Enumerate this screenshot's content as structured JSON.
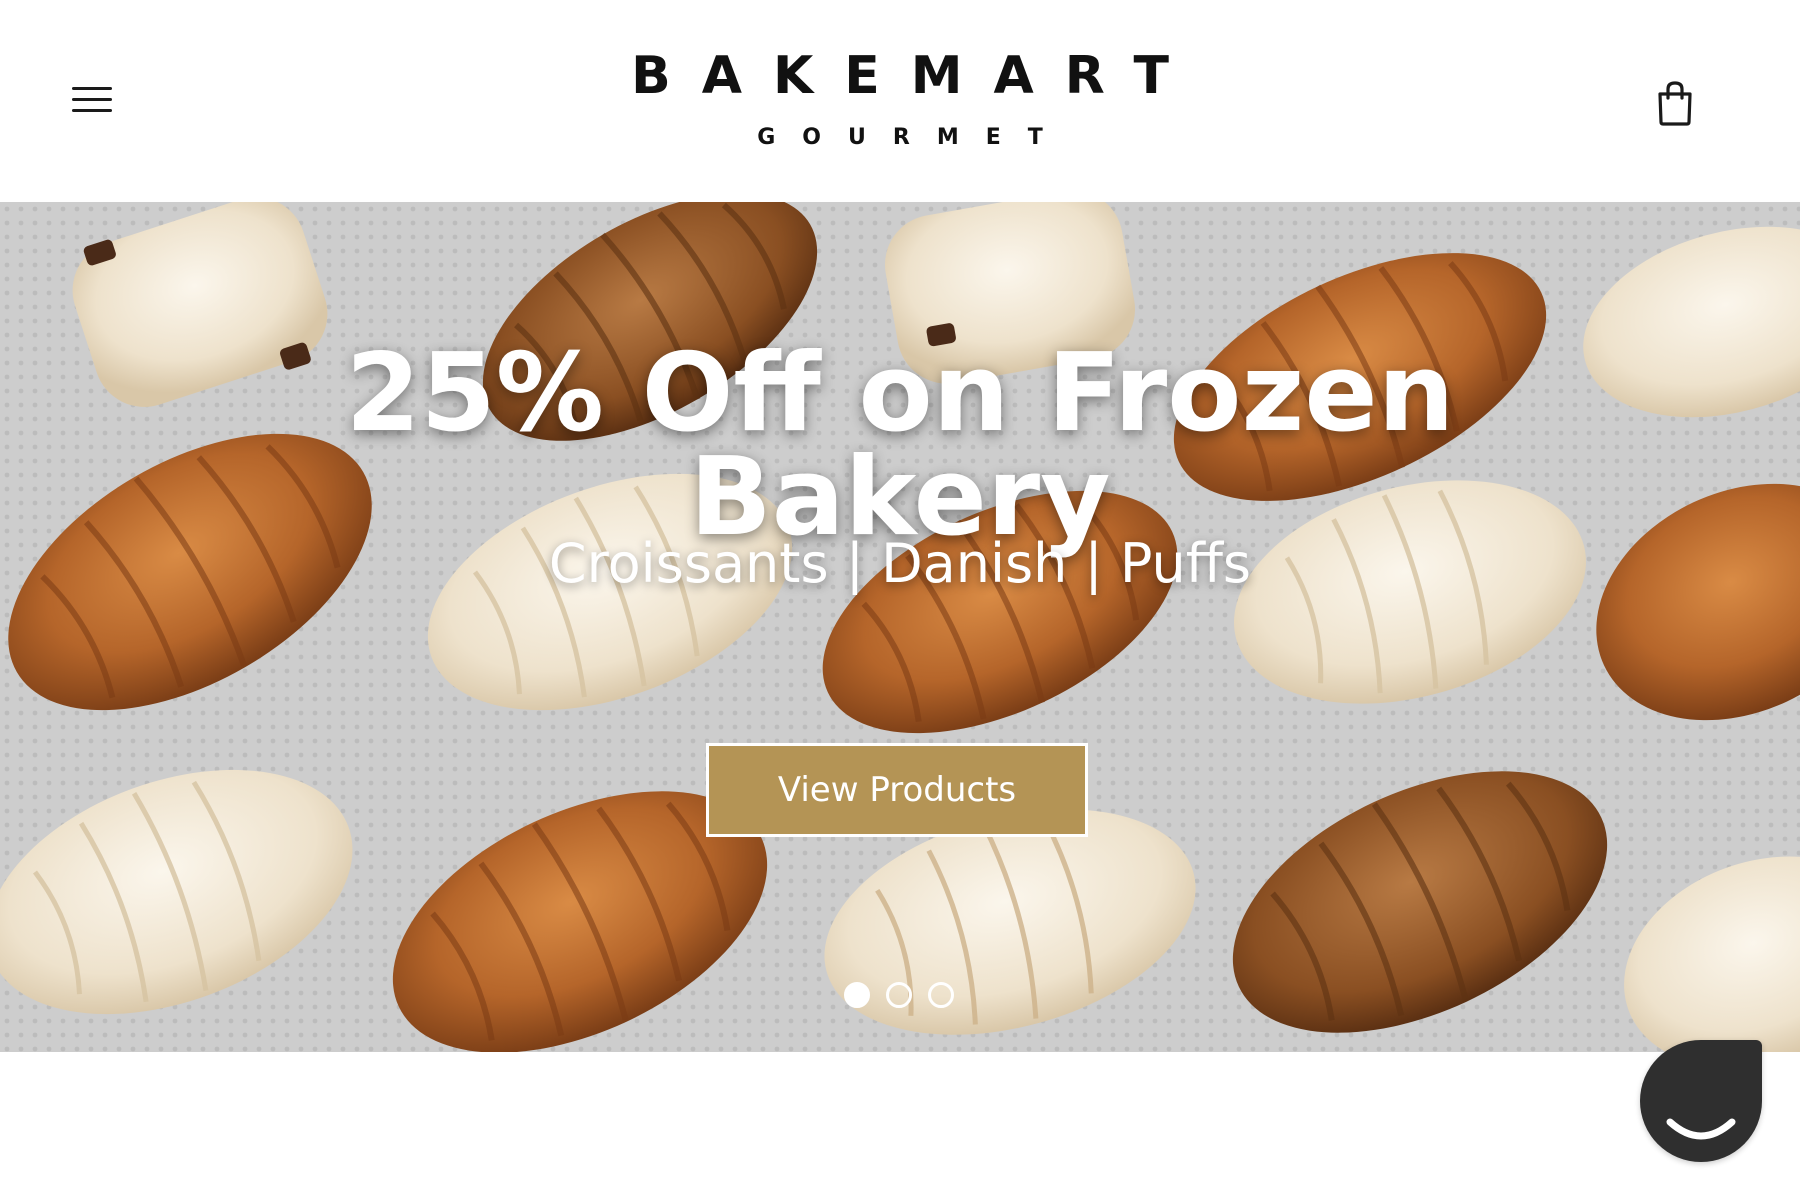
{
  "header": {
    "brand_name": "BAKEMART",
    "brand_sub": "GOURMET",
    "menu_icon": "hamburger-menu-icon",
    "cart_icon": "shopping-bag-icon"
  },
  "hero": {
    "title_line1": "25% Off on Frozen",
    "title_line2": "Bakery",
    "subtitle": "Croissants | Danish | Puffs",
    "cta_label": "View Products",
    "slides": [
      {
        "active": true
      },
      {
        "active": false
      },
      {
        "active": false
      }
    ]
  },
  "chat": {
    "icon": "smile-chat-icon"
  },
  "colors": {
    "cta_background": "#b49455",
    "text_dark": "#111111",
    "chat_widget": "#2f2f2f"
  }
}
